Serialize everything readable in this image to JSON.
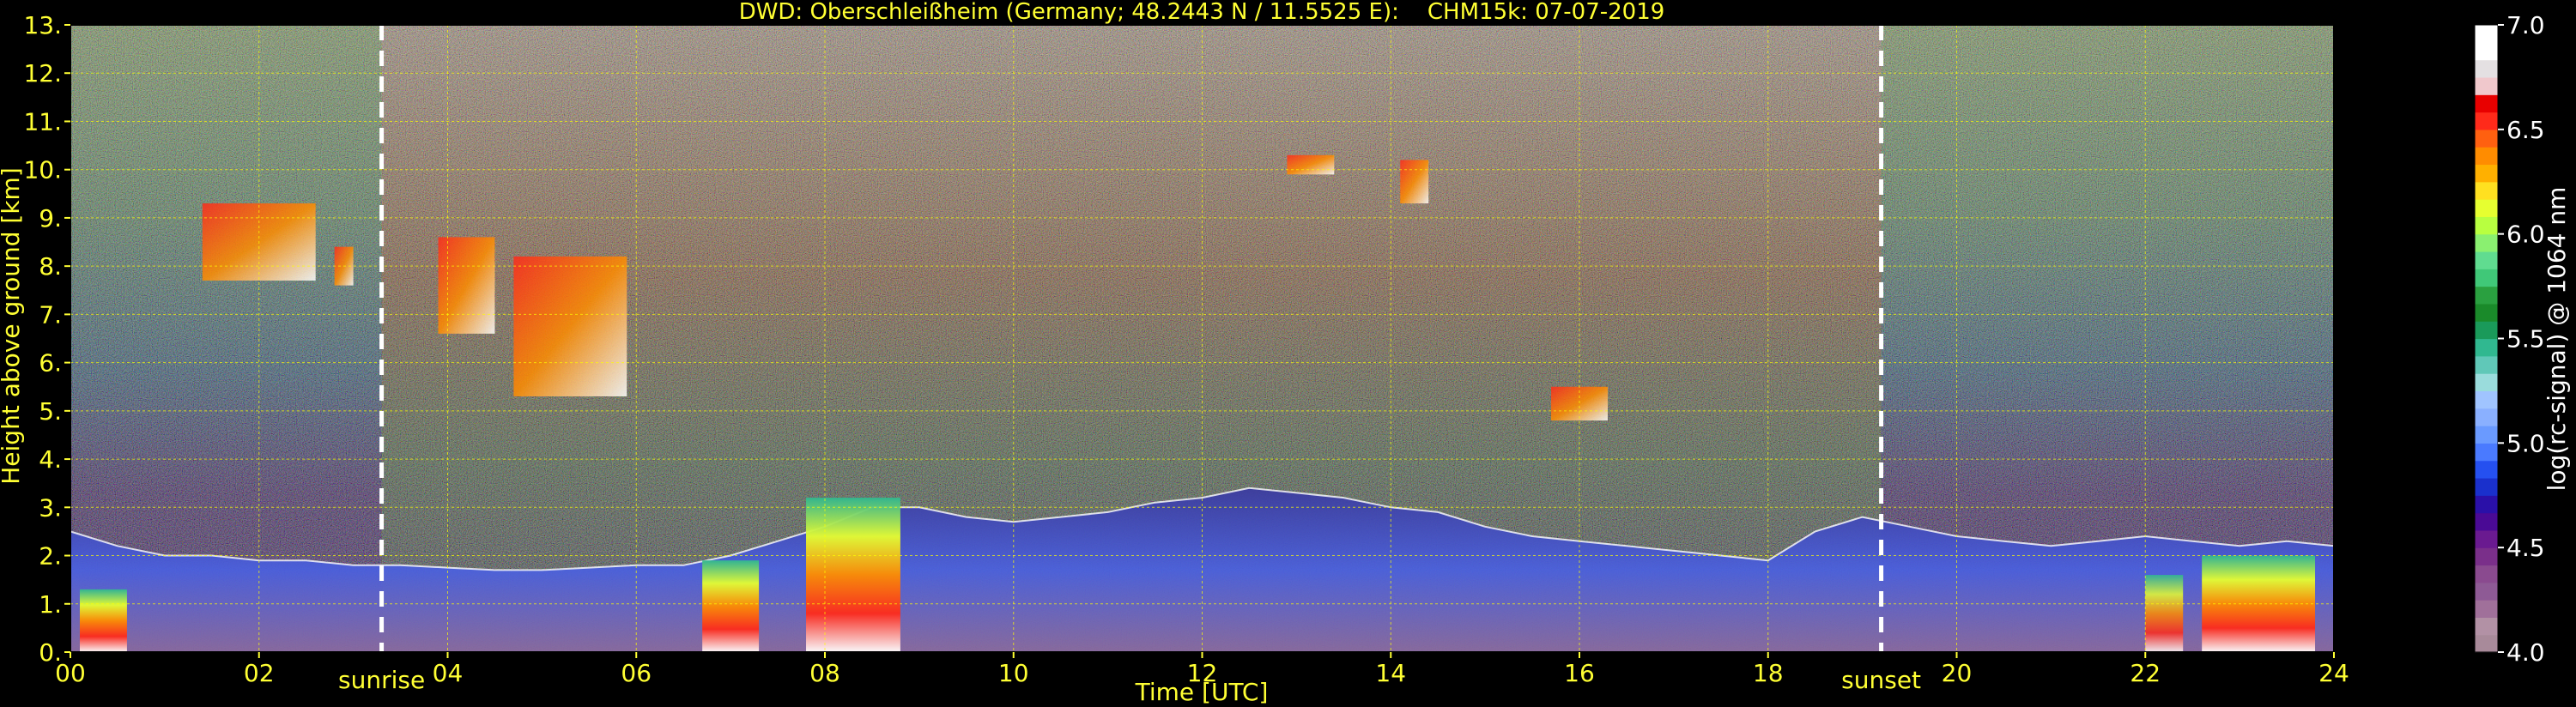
{
  "chart_data": {
    "type": "heatmap",
    "title": "DWD: Oberschleißheim (Germany; 48.2443 N / 11.5525 E):    CHM15k: 07-07-2019",
    "xlabel": "Time [UTC]",
    "ylabel": "Height above ground [km]",
    "colorbar_label": "log(rc-signal) @ 1064 nm",
    "xlim": [
      0,
      24
    ],
    "ylim": [
      0,
      13
    ],
    "x_ticks": [
      0,
      2,
      4,
      6,
      8,
      10,
      12,
      14,
      16,
      18,
      20,
      22,
      24
    ],
    "x_tick_labels": [
      "00",
      "02",
      "04",
      "06",
      "08",
      "10",
      "12",
      "14",
      "16",
      "18",
      "20",
      "22",
      "24"
    ],
    "y_ticks": [
      0,
      1,
      2,
      3,
      4,
      5,
      6,
      7,
      8,
      9,
      10,
      11,
      12,
      13
    ],
    "y_tick_labels": [
      "0.",
      "1.",
      "2.",
      "3.",
      "4.",
      "5.",
      "6.",
      "7.",
      "8.",
      "9.",
      "10.",
      "11.",
      "12.",
      "13."
    ],
    "grid": true,
    "colorbar": {
      "range": [
        4.0,
        7.0
      ],
      "ticks": [
        4.0,
        4.5,
        5.0,
        5.5,
        6.0,
        6.5,
        7.0
      ],
      "tick_labels": [
        "4.0",
        "4.5",
        "5.0",
        "5.5",
        "6.0",
        "6.5",
        "7.0"
      ],
      "colors": [
        "#a88a9a",
        "#b291a5",
        "#a0709a",
        "#8e5a95",
        "#8a4a8f",
        "#7a2f8a",
        "#6a1a90",
        "#4a0a95",
        "#2a10a8",
        "#1a30cc",
        "#2550f0",
        "#4a7aff",
        "#6a9aff",
        "#8ab0ff",
        "#a0c4ff",
        "#9adcdc",
        "#60c8b8",
        "#30b890",
        "#1a9a5a",
        "#1a8a2a",
        "#2aa040",
        "#40c878",
        "#60dc90",
        "#8af070",
        "#b8ff40",
        "#e6ff30",
        "#ffe020",
        "#ffb000",
        "#ff8c00",
        "#ff6010",
        "#ff2a1a",
        "#e80000",
        "#f0c8cc",
        "#e4e0e2",
        "#ffffff",
        "#ffffff"
      ]
    },
    "sunrise": {
      "label": "sunrise",
      "time": 3.3
    },
    "sunset": {
      "label": "sunset",
      "time": 19.2
    },
    "boundary_layer": {
      "x": [
        0,
        0.5,
        1,
        1.5,
        2,
        2.5,
        3,
        3.5,
        4,
        4.5,
        5,
        5.5,
        6,
        6.5,
        7,
        7.5,
        8,
        8.5,
        9,
        9.5,
        10,
        10.5,
        11,
        11.5,
        12,
        12.5,
        13,
        13.5,
        14,
        14.5,
        15,
        15.5,
        16,
        16.5,
        17,
        17.5,
        18,
        18.5,
        19,
        19.5,
        20,
        20.5,
        21,
        21.5,
        22,
        22.5,
        23,
        23.5,
        24
      ],
      "height": [
        2.5,
        2.2,
        2.0,
        2.0,
        1.9,
        1.9,
        1.8,
        1.8,
        1.75,
        1.7,
        1.7,
        1.75,
        1.8,
        1.8,
        2.0,
        2.3,
        2.6,
        3.0,
        3.0,
        2.8,
        2.7,
        2.8,
        2.9,
        3.1,
        3.2,
        3.4,
        3.3,
        3.2,
        3.0,
        2.9,
        2.6,
        2.4,
        2.3,
        2.2,
        2.1,
        2.0,
        1.9,
        2.5,
        2.8,
        2.6,
        2.4,
        2.3,
        2.2,
        2.3,
        2.4,
        2.3,
        2.2,
        2.3,
        2.2
      ]
    },
    "cloud_layers": [
      {
        "x": [
          1.4,
          2.6
        ],
        "y": [
          7.7,
          9.3
        ],
        "intensity": "high"
      },
      {
        "x": [
          2.8,
          3.0
        ],
        "y": [
          7.6,
          8.4
        ],
        "intensity": "high"
      },
      {
        "x": [
          3.9,
          4.5
        ],
        "y": [
          6.6,
          8.6
        ],
        "intensity": "high"
      },
      {
        "x": [
          4.7,
          5.9
        ],
        "y": [
          5.3,
          8.2
        ],
        "intensity": "high"
      },
      {
        "x": [
          12.9,
          13.4
        ],
        "y": [
          9.9,
          10.3
        ],
        "intensity": "high"
      },
      {
        "x": [
          14.1,
          14.4
        ],
        "y": [
          9.3,
          10.2
        ],
        "intensity": "high"
      },
      {
        "x": [
          15.7,
          16.3
        ],
        "y": [
          4.8,
          5.5
        ],
        "intensity": "high"
      },
      {
        "x": [
          7.8,
          8.8
        ],
        "y": [
          0.0,
          3.2
        ],
        "intensity": "very-high"
      },
      {
        "x": [
          6.7,
          7.3
        ],
        "y": [
          0.0,
          1.9
        ],
        "intensity": "very-high"
      },
      {
        "x": [
          22.6,
          23.8
        ],
        "y": [
          0.0,
          2.0
        ],
        "intensity": "very-high"
      },
      {
        "x": [
          22.0,
          22.4
        ],
        "y": [
          0.0,
          1.6
        ],
        "intensity": "high"
      },
      {
        "x": [
          0.1,
          0.6
        ],
        "y": [
          0.0,
          1.3
        ],
        "intensity": "very-high"
      }
    ]
  }
}
